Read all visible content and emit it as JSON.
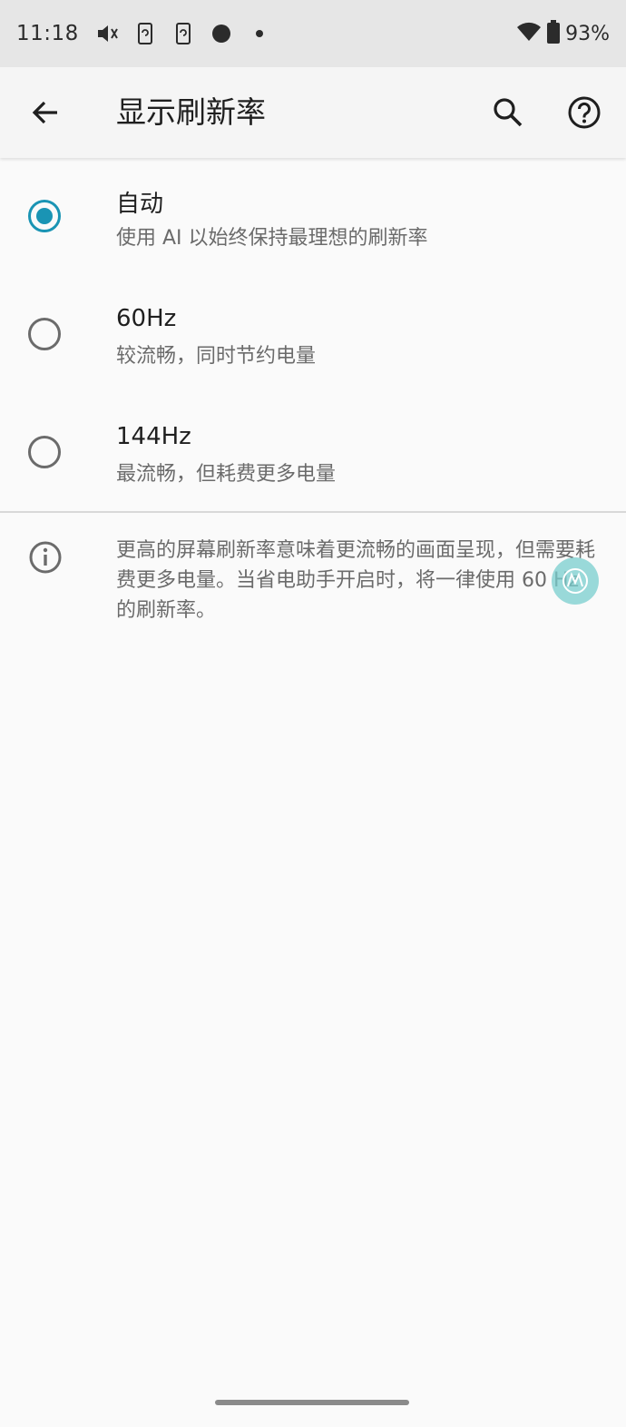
{
  "status_bar": {
    "time": "11:18",
    "battery": "93%",
    "icons_left": [
      "mute-icon",
      "phone-sync-icon",
      "phone-sync-icon",
      "dot-icon",
      "small-dot-icon"
    ],
    "icons_right": [
      "wifi-icon",
      "battery-icon"
    ]
  },
  "app_bar": {
    "title": "显示刷新率",
    "icons": [
      "back-arrow-icon",
      "search-icon",
      "help-icon"
    ]
  },
  "options": [
    {
      "title": "自动",
      "subtitle": "使用 AI 以始终保持最理想的刷新率",
      "selected": true
    },
    {
      "title": "60Hz",
      "subtitle": "较流畅，同时节约电量",
      "selected": false
    },
    {
      "title": "144Hz",
      "subtitle": "最流畅，但耗费更多电量",
      "selected": false
    }
  ],
  "info": {
    "text": "更高的屏幕刷新率意味着更流畅的画面呈现，但需要耗费更多电量。当省电助手开启时，将一律使用 60 Hz 的刷新率。"
  },
  "colors": {
    "accent": "#1a94b4",
    "status_bar_bg": "#e6e6e6",
    "background": "#fafafa",
    "secondary_text": "#6b6b6b",
    "assist_bubble": "#78cece"
  }
}
